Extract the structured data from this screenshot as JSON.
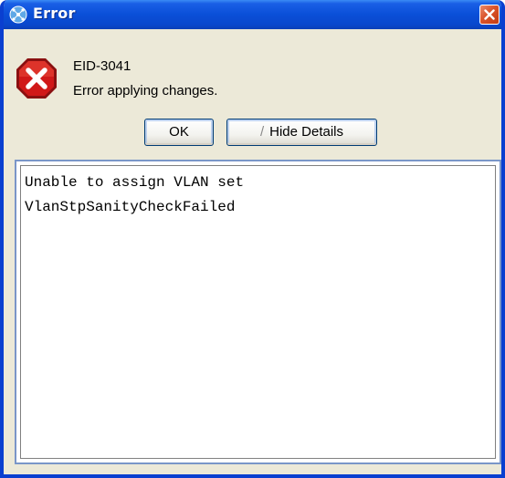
{
  "window": {
    "title": "Error",
    "close_label": "✕"
  },
  "error": {
    "code": "EID-3041",
    "message": "Error applying changes."
  },
  "buttons": {
    "ok_label": "OK",
    "hide_details_label": "Hide Details",
    "hide_details_glyph": "/"
  },
  "details": {
    "lines": [
      "Unable to assign VLAN set",
      "VlanStpSanityCheckFailed"
    ]
  },
  "icons": {
    "title": "network-app-icon",
    "close": "close-icon",
    "error": "error-stop-sign-icon"
  },
  "colors": {
    "titlebar": "#0a4fd8",
    "close_button": "#d9532a",
    "error_icon": "#d01818",
    "dialog_background": "#ece9d8"
  }
}
